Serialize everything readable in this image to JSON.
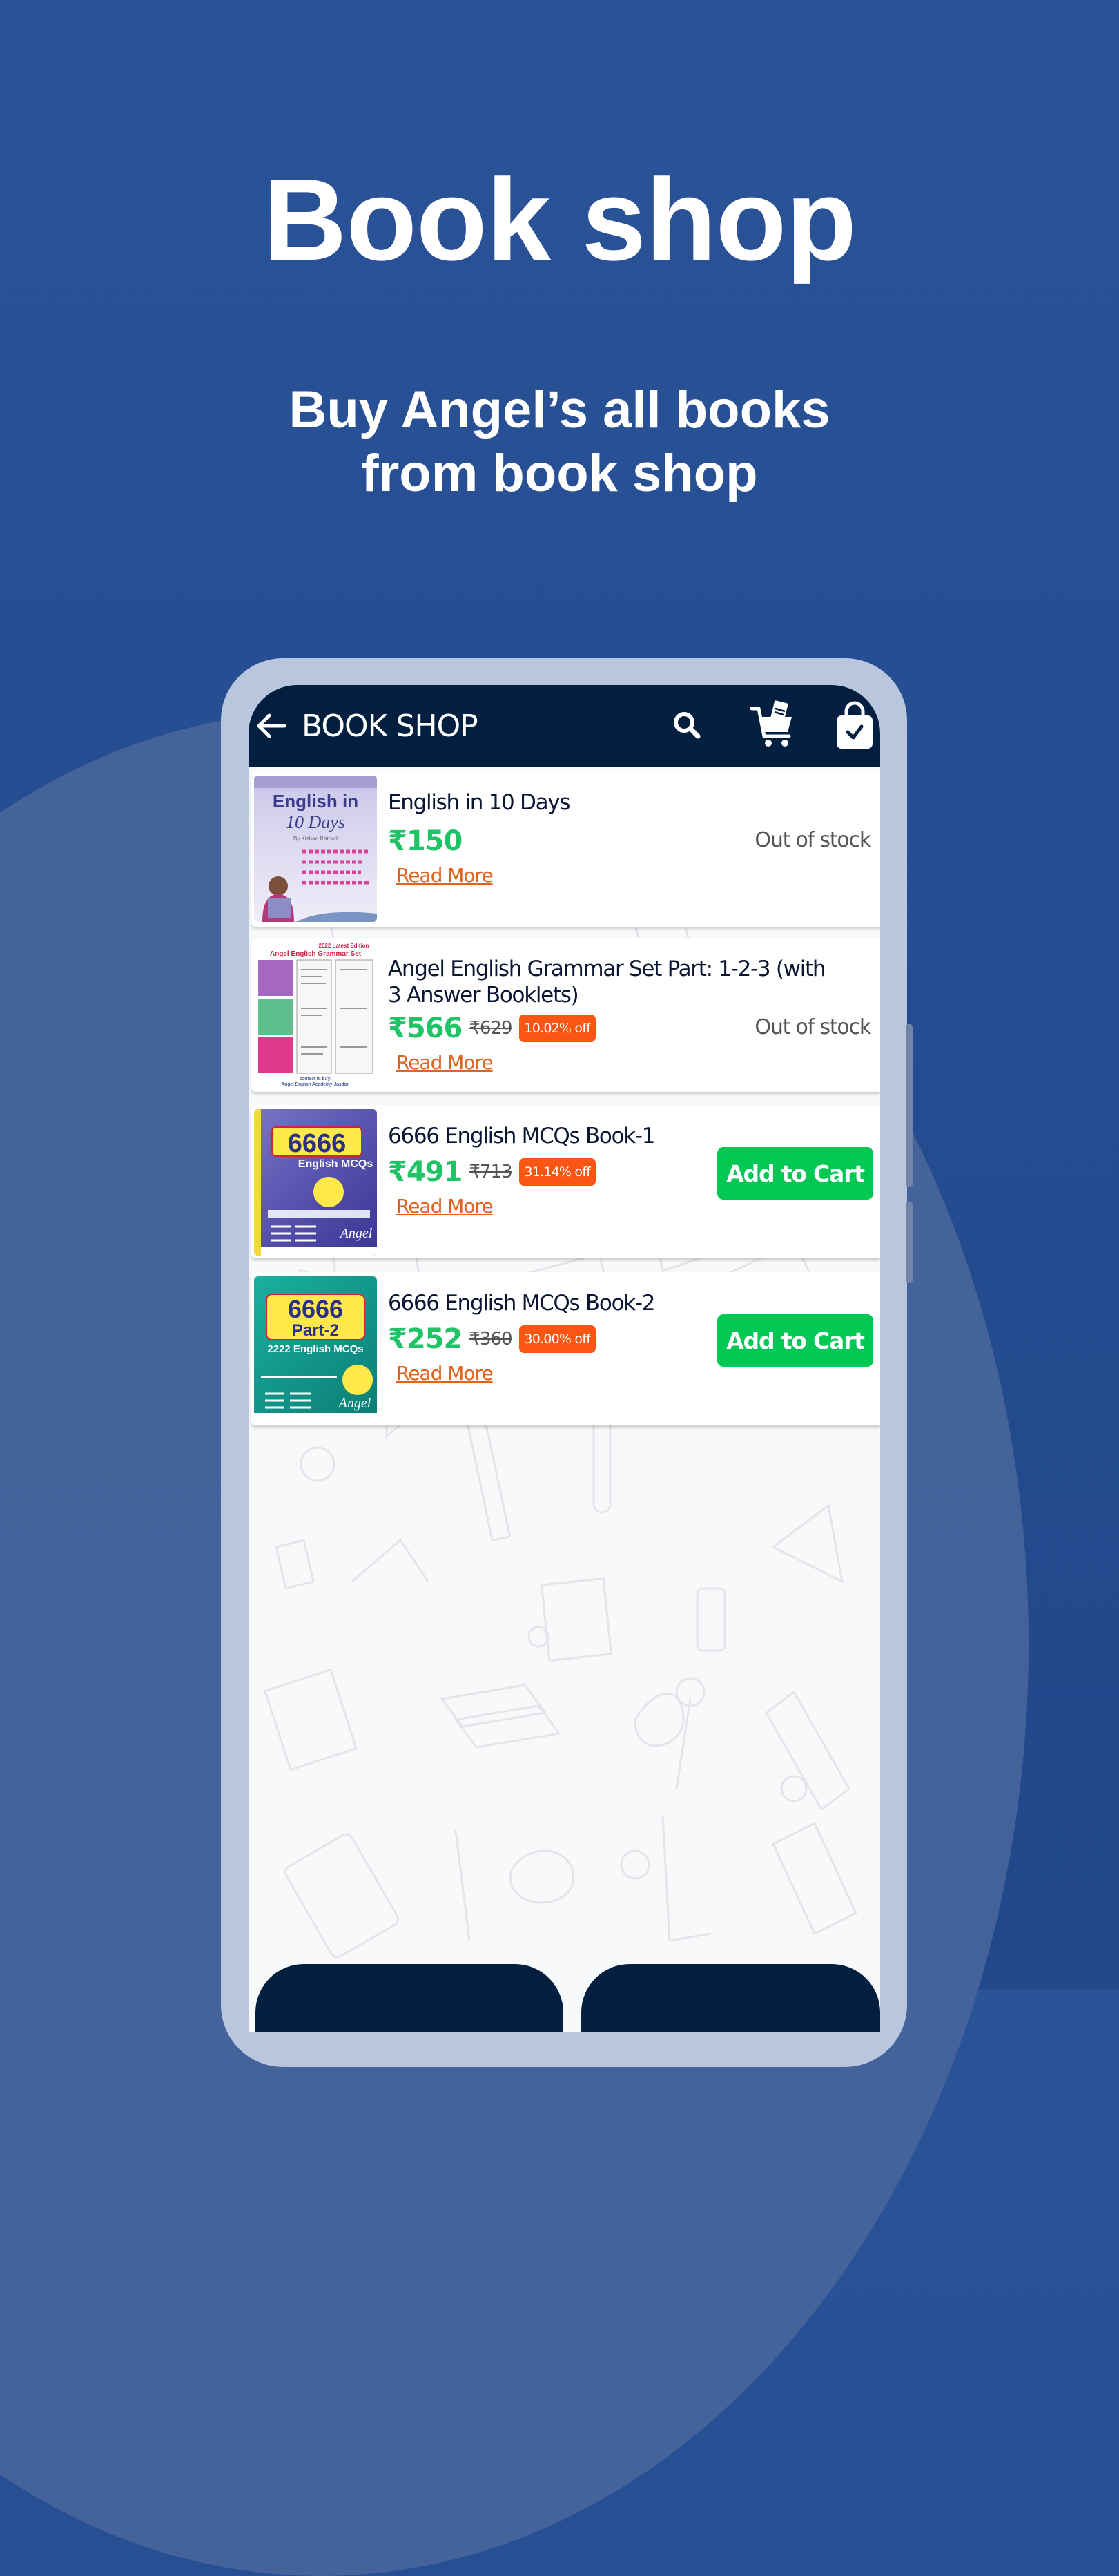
{
  "hero": {
    "title": "Book shop",
    "subtitle_line1": "Buy Angel’s all books",
    "subtitle_line2": "from book shop"
  },
  "appbar": {
    "title": "BOOK SHOP",
    "icons": [
      "back-arrow-icon",
      "search-icon",
      "book-cart-icon",
      "shopping-bag-check-icon"
    ]
  },
  "colors": {
    "background": "#2b5398",
    "appbar": "#021f3f",
    "price": "#1ec466",
    "discount_badge": "#fa5512",
    "read_more": "#e2631e",
    "add_to_cart": "#00c853"
  },
  "books": [
    {
      "title": "English in 10 Days",
      "price": "₹150",
      "mrp": null,
      "discount": null,
      "read_more": "Read More",
      "status": "Out of stock",
      "action": null,
      "cover": {
        "line1": "English in",
        "line2": "10 Days",
        "line3": "By Kishan Rathod"
      }
    },
    {
      "title": "Angel English Grammar Set Part: 1-2-3 (with 3 Answer Booklets)",
      "price": "₹566",
      "mrp": "₹629",
      "discount": "10.02% off",
      "read_more": "Read More",
      "status": "Out of stock",
      "action": null,
      "cover": {
        "line1": "2022 Latest Edition",
        "line2": "Angel English Grammar Set"
      }
    },
    {
      "title": "6666 English MCQs Book-1",
      "price": "₹491",
      "mrp": "₹713",
      "discount": "31.14% off",
      "read_more": "Read More",
      "status": null,
      "action": "Add to Cart",
      "cover": {
        "line1": "6666",
        "line2": "English MCQs",
        "line3": "Angel"
      }
    },
    {
      "title": "6666 English MCQs Book-2",
      "price": "₹252",
      "mrp": "₹360",
      "discount": "30.00% off",
      "read_more": "Read More",
      "status": null,
      "action": "Add to Cart",
      "cover": {
        "line1": "6666",
        "line2": "Part-2",
        "line3": "2222 English MCQs",
        "line4": "Angel"
      }
    }
  ]
}
